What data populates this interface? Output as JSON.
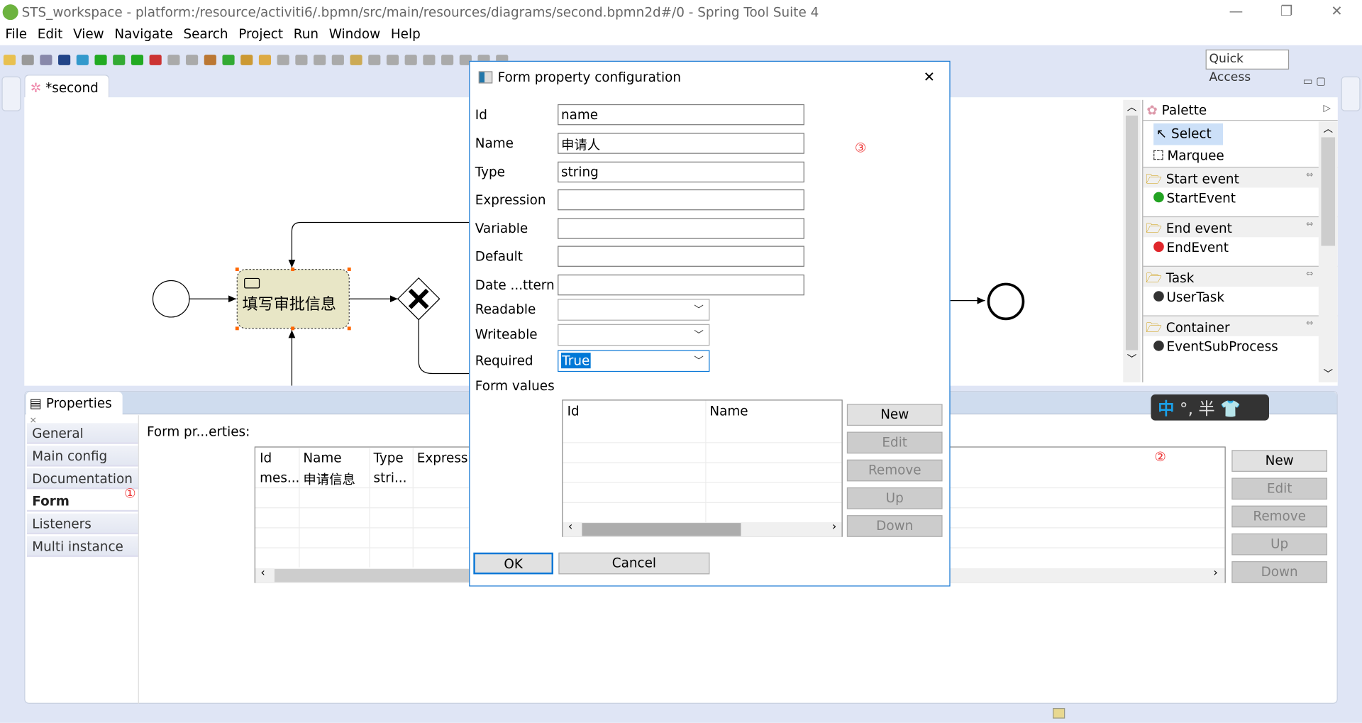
{
  "window": {
    "title": "STS_workspace - platform:/resource/activiti6/.bpmn/src/main/resources/diagrams/second.bpmn2d#/0 - Spring Tool Suite 4",
    "minimize": "—",
    "restore": "❐",
    "close": "✕"
  },
  "menu": [
    "File",
    "Edit",
    "View",
    "Navigate",
    "Search",
    "Project",
    "Run",
    "Window",
    "Help"
  ],
  "toolbar": {
    "quick_access": "Quick Access"
  },
  "editor": {
    "tab_label": "*second",
    "tab_close": "✕",
    "task_label": "填写审批信息"
  },
  "palette": {
    "title": "Palette",
    "items": [
      {
        "label": "Select",
        "icon": "cursor-icon",
        "selected": true
      },
      {
        "label": "Marquee",
        "icon": "marquee-icon"
      }
    ],
    "groups": [
      {
        "label": "Start event",
        "item": "StartEvent",
        "color": "#22a322"
      },
      {
        "label": "End event",
        "item": "EndEvent",
        "color": "#e0262b"
      },
      {
        "label": "Task",
        "item": "UserTask",
        "color": "#333333"
      },
      {
        "label": "Container",
        "item": "EventSubProcess",
        "color": "#333333"
      }
    ]
  },
  "properties": {
    "tab_label": "Properties",
    "tabs": [
      "General",
      "Main config",
      "Documentation",
      "Form",
      "Listeners",
      "Multi instance"
    ],
    "selected_tab": "Form",
    "section_label": "Form pr...erties:",
    "columns": [
      "Id",
      "Name",
      "Type",
      "Expressi..."
    ],
    "rows": [
      [
        "mes...",
        "申请信息",
        "stri...",
        ""
      ]
    ],
    "buttons": [
      "New",
      "Edit",
      "Remove",
      "Up",
      "Down"
    ],
    "annotations": {
      "one": "①",
      "two": "②"
    }
  },
  "ime": {
    "mode": "中",
    "punct": "°,",
    "width": "半"
  },
  "dialog": {
    "title": "Form property configuration",
    "close": "✕",
    "annotation": "③",
    "fields": {
      "id_label": "Id",
      "id": "name",
      "name_label": "Name",
      "name": "申请人",
      "type_label": "Type",
      "type": "string",
      "expression_label": "Expression",
      "expression": "",
      "variable_label": "Variable",
      "variable": "",
      "default_label": "Default",
      "default": "",
      "date_label": "Date ...ttern",
      "date_pattern": ""
    },
    "selects": {
      "readable_label": "Readable",
      "readable": "",
      "writeable_label": "Writeable",
      "writeable": "",
      "required_label": "Required",
      "required": "True"
    },
    "form_values_label": "Form values",
    "form_values_columns": [
      "Id",
      "Name"
    ],
    "buttons": [
      "New",
      "Edit",
      "Remove",
      "Up",
      "Down"
    ],
    "ok": "OK",
    "cancel": "Cancel"
  }
}
